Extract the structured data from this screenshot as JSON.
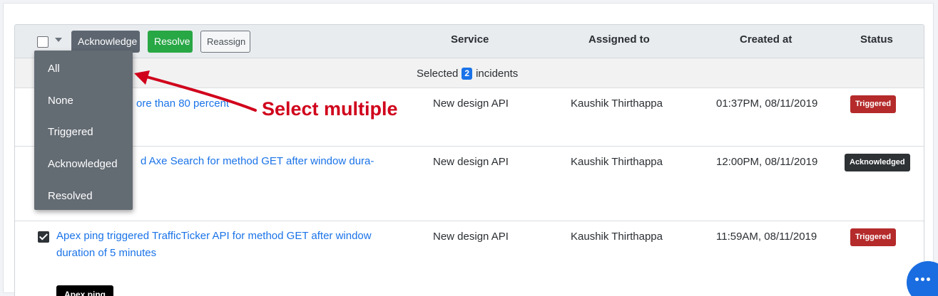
{
  "header": {
    "acknowledge_label": "Acknowledge",
    "resolve_label": "Resolve",
    "reassign_label": "Reassign",
    "columns": {
      "service": "Service",
      "assigned_to": "Assigned to",
      "created_at": "Created at",
      "status": "Status"
    }
  },
  "selection": {
    "prefix": "Selected",
    "count": "2",
    "suffix": "incidents"
  },
  "dropdown": {
    "items": [
      "All",
      "None",
      "Triggered",
      "Acknowledged",
      "Resolved"
    ]
  },
  "annotation": {
    "text": "Select multiple"
  },
  "rows": [
    {
      "title": "ore than 80 percent",
      "service": "New design API",
      "assignee": "Kaushik Thirthappa",
      "created": "01:37PM, 08/11/2019",
      "status": "Triggered"
    },
    {
      "title": "d Axe Search for method GET after window dura-",
      "service": "New design API",
      "assignee": "Kaushik Thirthappa",
      "created": "12:00PM, 08/11/2019",
      "status": "Acknowledged"
    },
    {
      "title_line1": "Apex ping triggered TrafficTicker API for method GET after window",
      "title_line2": "duration of 5 minutes",
      "tag": "Apex ping",
      "service": "New design API",
      "assignee": "Kaushik Thirthappa",
      "created": "11:59AM, 08/11/2019",
      "status": "Triggered",
      "checked": true
    }
  ],
  "colors": {
    "accent": "#1a73e8",
    "triggered": "#b52a2a",
    "acknowledged": "#2e3235",
    "resolve": "#28a745",
    "annotation": "#d0021b"
  }
}
